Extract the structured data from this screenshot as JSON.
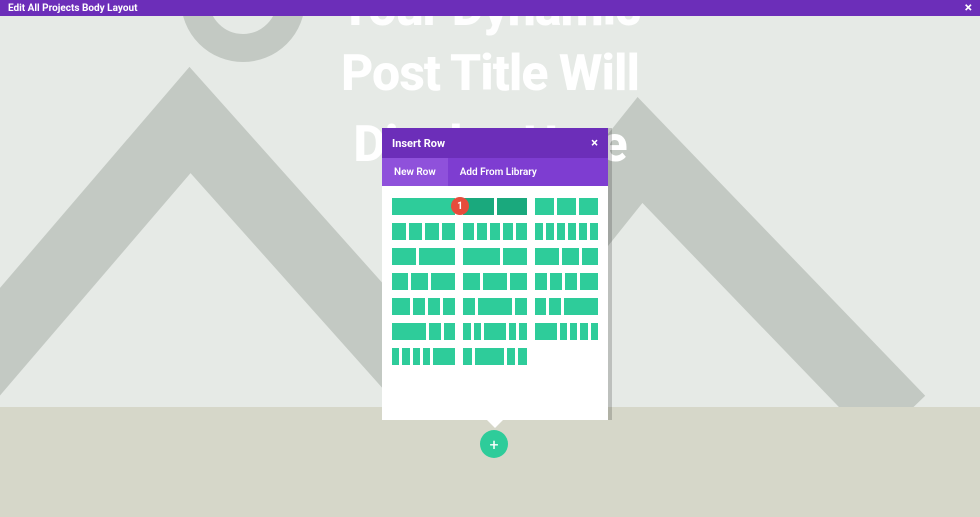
{
  "topbar": {
    "title": "Edit All Projects Body Layout",
    "close_glyph": "×"
  },
  "hero": {
    "line1": "Your Dynamic",
    "line2": "Post Title Will",
    "line3": "Display Here"
  },
  "modal": {
    "title": "Insert Row",
    "close_glyph": "×",
    "tabs": {
      "new_row": "New Row",
      "add_from_library": "Add From Library"
    },
    "badge_number": "1"
  },
  "fab": {
    "plus_glyph": "+"
  },
  "row_layouts": [
    [
      [
        1
      ],
      [
        1,
        1
      ],
      [
        1,
        1,
        1
      ]
    ],
    [
      [
        1,
        1,
        1,
        1
      ],
      [
        1,
        1,
        1,
        1,
        1
      ],
      [
        1,
        1,
        1,
        1,
        1,
        1
      ]
    ],
    [
      [
        2,
        3
      ],
      [
        3,
        2
      ],
      [
        3,
        2,
        2
      ]
    ],
    [
      [
        2,
        2,
        3
      ],
      [
        2,
        3,
        2
      ],
      [
        2,
        2,
        2,
        3
      ]
    ],
    [
      [
        3,
        2,
        2,
        2
      ],
      [
        2,
        6,
        2
      ],
      [
        2,
        2,
        6
      ]
    ],
    [
      [
        6,
        2,
        2
      ],
      [
        2,
        2,
        6,
        2,
        2
      ],
      [
        6,
        2,
        2,
        2,
        2
      ]
    ],
    [
      [
        2,
        2,
        2,
        2,
        6
      ],
      [
        2,
        7,
        2,
        2
      ],
      []
    ]
  ]
}
